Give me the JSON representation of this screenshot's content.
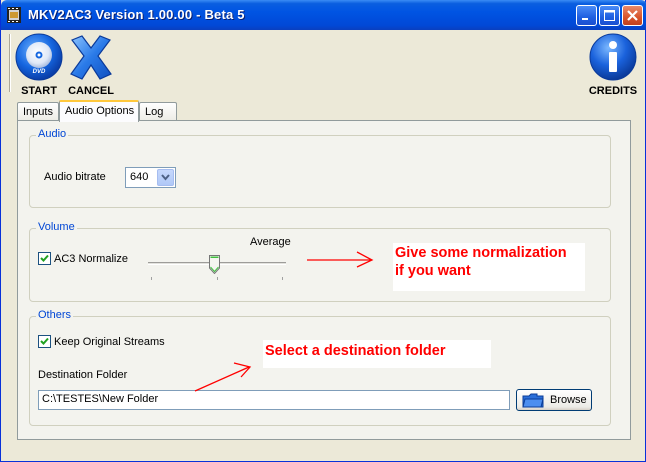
{
  "window": {
    "title": "MKV2AC3 Version 1.00.00 - Beta 5",
    "controls": [
      "minimize",
      "maximize",
      "close"
    ]
  },
  "toolbar": {
    "start_label": "START",
    "start_icon_text": "DVD",
    "cancel_label": "CANCEL",
    "credits_label": "CREDITS"
  },
  "tabs": [
    {
      "label": "Inputs",
      "active": false
    },
    {
      "label": "Audio Options",
      "active": true
    },
    {
      "label": "Log",
      "active": false
    }
  ],
  "audio": {
    "group_title": "Audio",
    "bitrate_label": "Audio bitrate",
    "bitrate_value": "640"
  },
  "volume": {
    "group_title": "Volume",
    "normalize_label": "AC3 Normalize",
    "normalize_checked": true,
    "slider_label": "Average",
    "slider_position": 0.5
  },
  "others": {
    "group_title": "Others",
    "keep_streams_label": "Keep Original Streams",
    "keep_streams_checked": true,
    "destination_label": "Destination Folder",
    "destination_value": "C:\\TESTES\\New Folder",
    "browse_label": "Browse"
  },
  "annotations": {
    "normalize_line1": "Give some normalization",
    "normalize_line2": "if you want",
    "destination": "Select a destination folder"
  },
  "colors": {
    "titlebar": "#0054e3",
    "group_title": "#0046d5",
    "annotation": "#ff0000"
  }
}
